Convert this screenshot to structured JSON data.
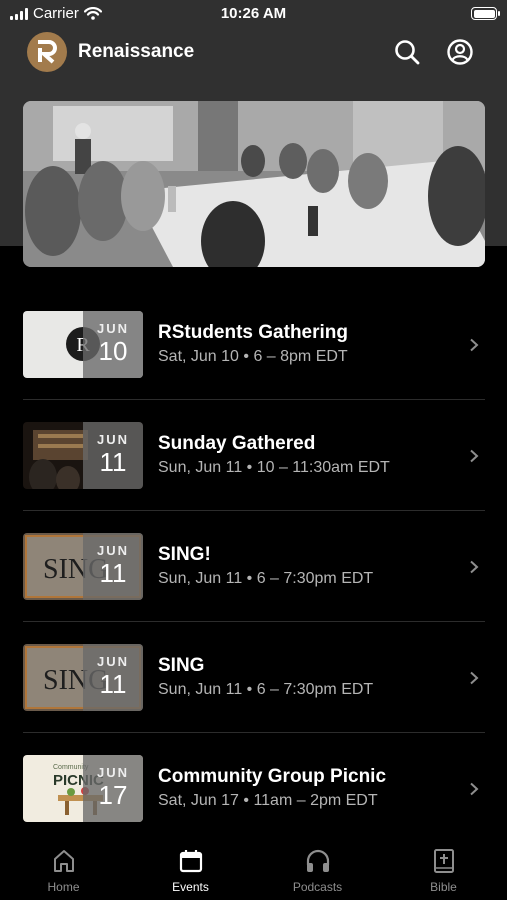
{
  "status_bar": {
    "carrier": "Carrier",
    "time": "10:26 AM"
  },
  "header": {
    "logo_letter": "R",
    "title": "Renaissance",
    "search_icon": "search-icon",
    "account_icon": "account-icon"
  },
  "events": [
    {
      "title": "RStudents Gathering",
      "subtitle": "Sat, Jun 10 • 6 – 8pm EDT",
      "month": "JUN",
      "day": "10"
    },
    {
      "title": "Sunday Gathered",
      "subtitle": "Sun, Jun 11 • 10 – 11:30am EDT",
      "month": "JUN",
      "day": "11"
    },
    {
      "title": "SING!",
      "subtitle": "Sun, Jun 11 • 6 – 7:30pm EDT",
      "month": "JUN",
      "day": "11",
      "thumb_text": "SING"
    },
    {
      "title": "SING",
      "subtitle": "Sun, Jun 11 • 6 – 7:30pm EDT",
      "month": "JUN",
      "day": "11",
      "thumb_text": "SING"
    },
    {
      "title": "Community Group Picnic",
      "subtitle": "Sat, Jun 17 • 11am – 2pm EDT",
      "month": "JUN",
      "day": "17",
      "thumb_text": "PICNIC",
      "thumb_small": "Community"
    }
  ],
  "tabs": [
    {
      "label": "Home",
      "icon": "home-icon"
    },
    {
      "label": "Events",
      "icon": "calendar-icon",
      "active": true
    },
    {
      "label": "Podcasts",
      "icon": "headphones-icon"
    },
    {
      "label": "Bible",
      "icon": "bible-icon"
    }
  ],
  "colors": {
    "brand": "#a27b4c",
    "header_bg": "#303030",
    "background": "#000000",
    "subtle_text": "#b5b5b5"
  }
}
